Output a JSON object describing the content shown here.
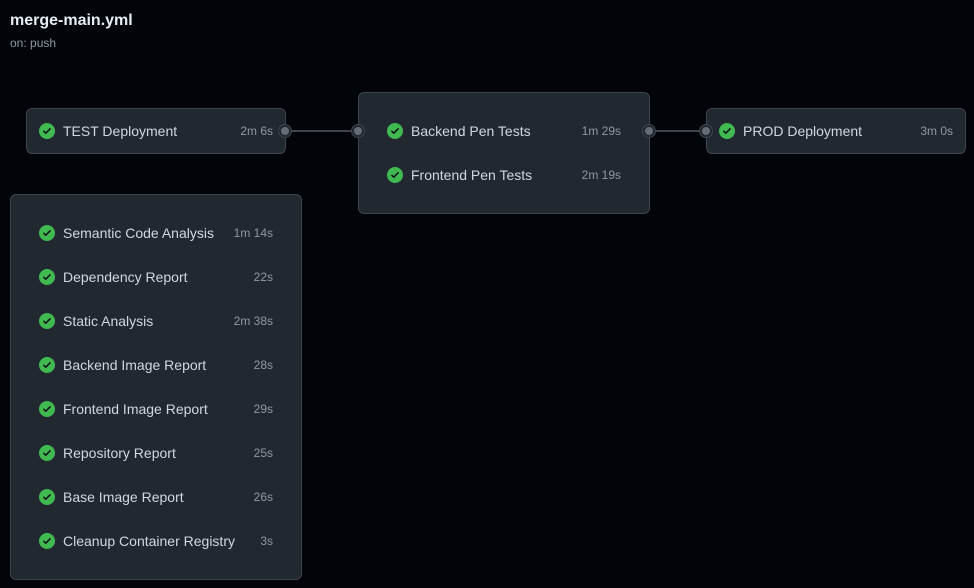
{
  "workflow": {
    "title": "merge-main.yml",
    "trigger": "on: push"
  },
  "colors": {
    "background": "#010409",
    "card": "#212830",
    "success": "#3fb950",
    "connector": "#3d444d"
  },
  "stages": [
    {
      "jobs": [
        {
          "name": "TEST Deployment",
          "duration": "2m 6s",
          "status": "success"
        }
      ]
    },
    {
      "jobs": [
        {
          "name": "Backend Pen Tests",
          "duration": "1m 29s",
          "status": "success"
        },
        {
          "name": "Frontend Pen Tests",
          "duration": "2m 19s",
          "status": "success"
        }
      ]
    },
    {
      "jobs": [
        {
          "name": "PROD Deployment",
          "duration": "3m 0s",
          "status": "success"
        }
      ]
    },
    {
      "jobs": [
        {
          "name": "Semantic Code Analysis",
          "duration": "1m 14s",
          "status": "success"
        },
        {
          "name": "Dependency Report",
          "duration": "22s",
          "status": "success"
        },
        {
          "name": "Static Analysis",
          "duration": "2m 38s",
          "status": "success"
        },
        {
          "name": "Backend Image Report",
          "duration": "28s",
          "status": "success"
        },
        {
          "name": "Frontend Image Report",
          "duration": "29s",
          "status": "success"
        },
        {
          "name": "Repository Report",
          "duration": "25s",
          "status": "success"
        },
        {
          "name": "Base Image Report",
          "duration": "26s",
          "status": "success"
        },
        {
          "name": "Cleanup Container Registry",
          "duration": "3s",
          "status": "success"
        }
      ]
    }
  ]
}
